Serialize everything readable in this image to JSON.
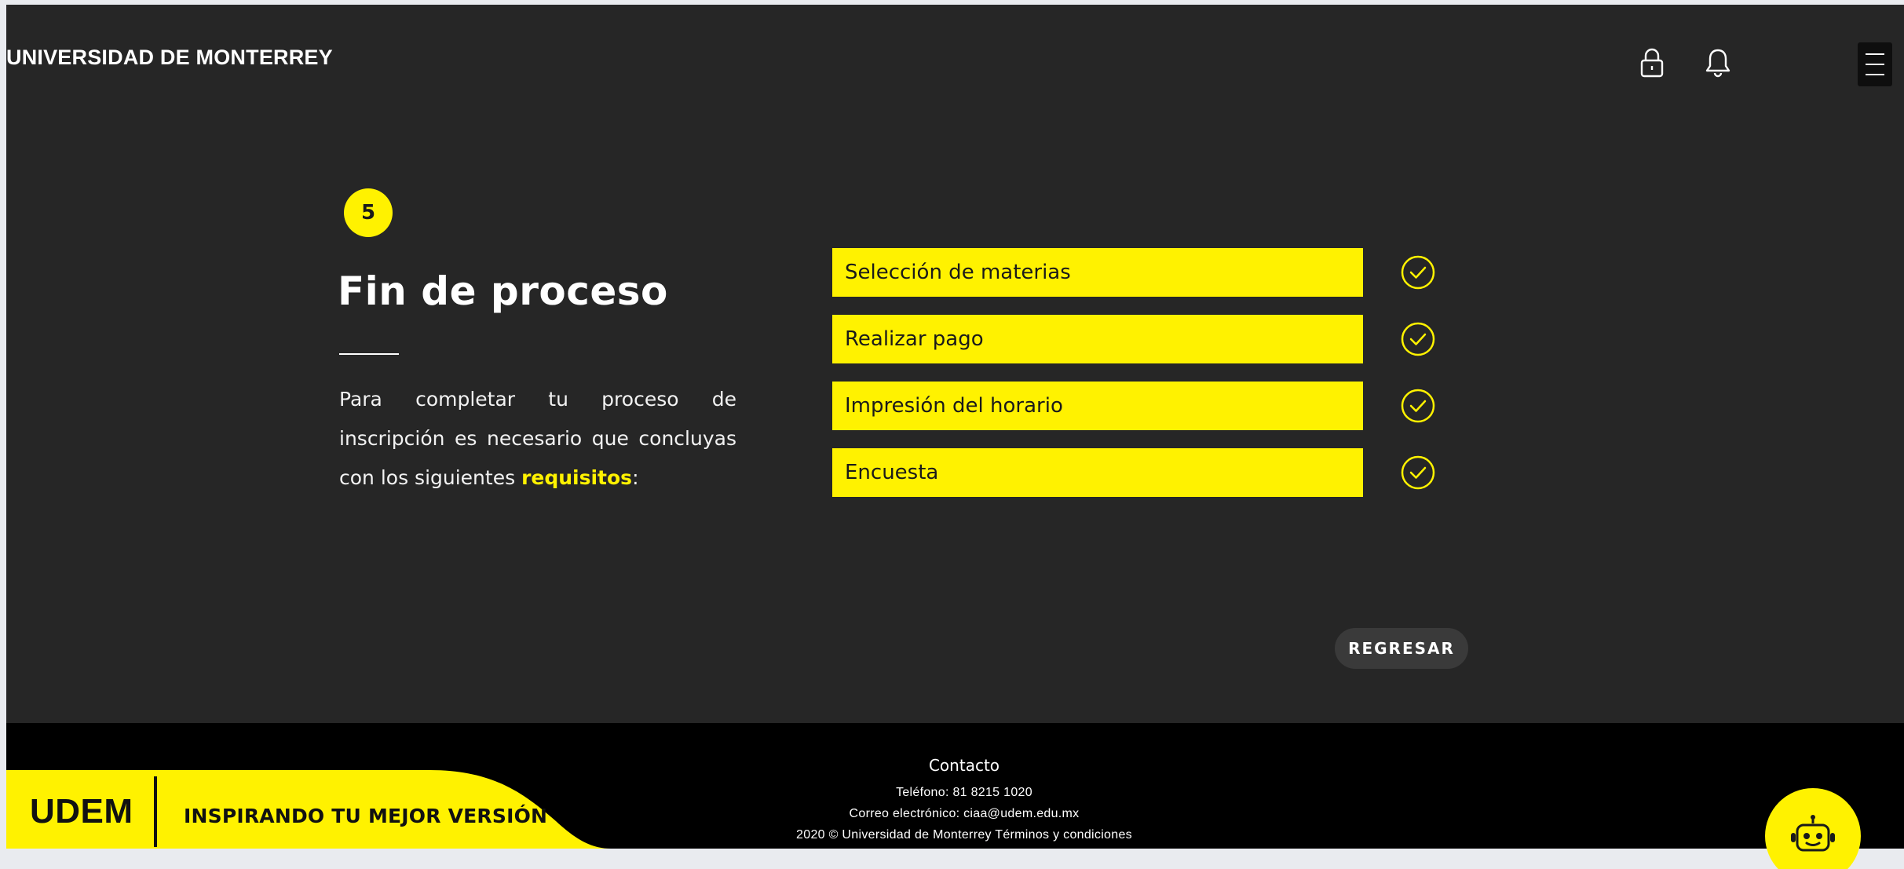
{
  "header": {
    "brand": "UNIVERSIDAD DE MONTERREY",
    "icons": [
      "lock-icon",
      "bell-icon",
      "menu-icon"
    ]
  },
  "step": {
    "number": "5",
    "title": "Fin de proceso",
    "description_prefix": "Para completar tu proceso de inscripción es necesario que concluyas con los siguientes ",
    "description_highlight": "requisitos",
    "description_suffix": ":"
  },
  "requirements": [
    {
      "label": "Selección de materias",
      "status": "check-circle-icon"
    },
    {
      "label": "Realizar pago",
      "status": "check-circle-icon"
    },
    {
      "label": "Impresión del horario",
      "status": "check-circle-icon"
    },
    {
      "label": "Encuesta",
      "status": "check-circle-icon"
    }
  ],
  "actions": {
    "back_label": "REGRESAR"
  },
  "footer": {
    "logo_text": "UDEM",
    "tagline": "INSPIRANDO TU MEJOR VERSIÓN",
    "contact_title": "Contacto",
    "phone": "Teléfono: 81 8215 1020",
    "email": "Correo electrónico: ciaa@udem.edu.mx",
    "copyright": "2020 © Universidad de Monterrey Términos y condiciones"
  },
  "colors": {
    "accent": "#fff200",
    "background": "#262626",
    "footer": "#000000",
    "page": "#e9ebef"
  }
}
